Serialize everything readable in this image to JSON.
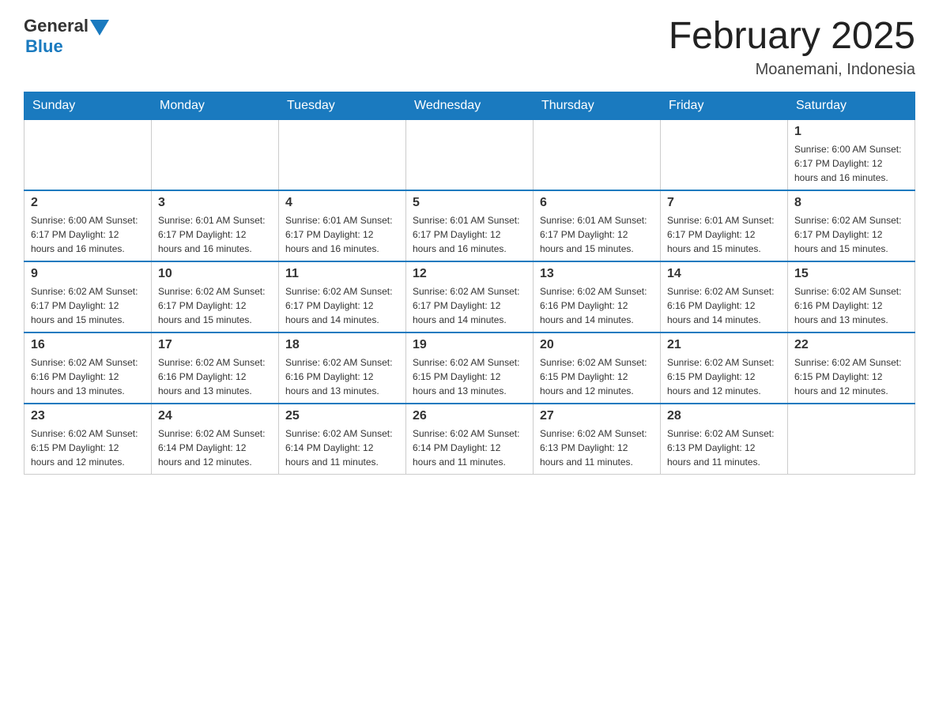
{
  "logo": {
    "general": "General",
    "blue": "Blue"
  },
  "header": {
    "title": "February 2025",
    "subtitle": "Moanemani, Indonesia"
  },
  "weekdays": [
    "Sunday",
    "Monday",
    "Tuesday",
    "Wednesday",
    "Thursday",
    "Friday",
    "Saturday"
  ],
  "weeks": [
    [
      {
        "day": "",
        "info": ""
      },
      {
        "day": "",
        "info": ""
      },
      {
        "day": "",
        "info": ""
      },
      {
        "day": "",
        "info": ""
      },
      {
        "day": "",
        "info": ""
      },
      {
        "day": "",
        "info": ""
      },
      {
        "day": "1",
        "info": "Sunrise: 6:00 AM\nSunset: 6:17 PM\nDaylight: 12 hours\nand 16 minutes."
      }
    ],
    [
      {
        "day": "2",
        "info": "Sunrise: 6:00 AM\nSunset: 6:17 PM\nDaylight: 12 hours\nand 16 minutes."
      },
      {
        "day": "3",
        "info": "Sunrise: 6:01 AM\nSunset: 6:17 PM\nDaylight: 12 hours\nand 16 minutes."
      },
      {
        "day": "4",
        "info": "Sunrise: 6:01 AM\nSunset: 6:17 PM\nDaylight: 12 hours\nand 16 minutes."
      },
      {
        "day": "5",
        "info": "Sunrise: 6:01 AM\nSunset: 6:17 PM\nDaylight: 12 hours\nand 16 minutes."
      },
      {
        "day": "6",
        "info": "Sunrise: 6:01 AM\nSunset: 6:17 PM\nDaylight: 12 hours\nand 15 minutes."
      },
      {
        "day": "7",
        "info": "Sunrise: 6:01 AM\nSunset: 6:17 PM\nDaylight: 12 hours\nand 15 minutes."
      },
      {
        "day": "8",
        "info": "Sunrise: 6:02 AM\nSunset: 6:17 PM\nDaylight: 12 hours\nand 15 minutes."
      }
    ],
    [
      {
        "day": "9",
        "info": "Sunrise: 6:02 AM\nSunset: 6:17 PM\nDaylight: 12 hours\nand 15 minutes."
      },
      {
        "day": "10",
        "info": "Sunrise: 6:02 AM\nSunset: 6:17 PM\nDaylight: 12 hours\nand 15 minutes."
      },
      {
        "day": "11",
        "info": "Sunrise: 6:02 AM\nSunset: 6:17 PM\nDaylight: 12 hours\nand 14 minutes."
      },
      {
        "day": "12",
        "info": "Sunrise: 6:02 AM\nSunset: 6:17 PM\nDaylight: 12 hours\nand 14 minutes."
      },
      {
        "day": "13",
        "info": "Sunrise: 6:02 AM\nSunset: 6:16 PM\nDaylight: 12 hours\nand 14 minutes."
      },
      {
        "day": "14",
        "info": "Sunrise: 6:02 AM\nSunset: 6:16 PM\nDaylight: 12 hours\nand 14 minutes."
      },
      {
        "day": "15",
        "info": "Sunrise: 6:02 AM\nSunset: 6:16 PM\nDaylight: 12 hours\nand 13 minutes."
      }
    ],
    [
      {
        "day": "16",
        "info": "Sunrise: 6:02 AM\nSunset: 6:16 PM\nDaylight: 12 hours\nand 13 minutes."
      },
      {
        "day": "17",
        "info": "Sunrise: 6:02 AM\nSunset: 6:16 PM\nDaylight: 12 hours\nand 13 minutes."
      },
      {
        "day": "18",
        "info": "Sunrise: 6:02 AM\nSunset: 6:16 PM\nDaylight: 12 hours\nand 13 minutes."
      },
      {
        "day": "19",
        "info": "Sunrise: 6:02 AM\nSunset: 6:15 PM\nDaylight: 12 hours\nand 13 minutes."
      },
      {
        "day": "20",
        "info": "Sunrise: 6:02 AM\nSunset: 6:15 PM\nDaylight: 12 hours\nand 12 minutes."
      },
      {
        "day": "21",
        "info": "Sunrise: 6:02 AM\nSunset: 6:15 PM\nDaylight: 12 hours\nand 12 minutes."
      },
      {
        "day": "22",
        "info": "Sunrise: 6:02 AM\nSunset: 6:15 PM\nDaylight: 12 hours\nand 12 minutes."
      }
    ],
    [
      {
        "day": "23",
        "info": "Sunrise: 6:02 AM\nSunset: 6:15 PM\nDaylight: 12 hours\nand 12 minutes."
      },
      {
        "day": "24",
        "info": "Sunrise: 6:02 AM\nSunset: 6:14 PM\nDaylight: 12 hours\nand 12 minutes."
      },
      {
        "day": "25",
        "info": "Sunrise: 6:02 AM\nSunset: 6:14 PM\nDaylight: 12 hours\nand 11 minutes."
      },
      {
        "day": "26",
        "info": "Sunrise: 6:02 AM\nSunset: 6:14 PM\nDaylight: 12 hours\nand 11 minutes."
      },
      {
        "day": "27",
        "info": "Sunrise: 6:02 AM\nSunset: 6:13 PM\nDaylight: 12 hours\nand 11 minutes."
      },
      {
        "day": "28",
        "info": "Sunrise: 6:02 AM\nSunset: 6:13 PM\nDaylight: 12 hours\nand 11 minutes."
      },
      {
        "day": "",
        "info": ""
      }
    ]
  ]
}
